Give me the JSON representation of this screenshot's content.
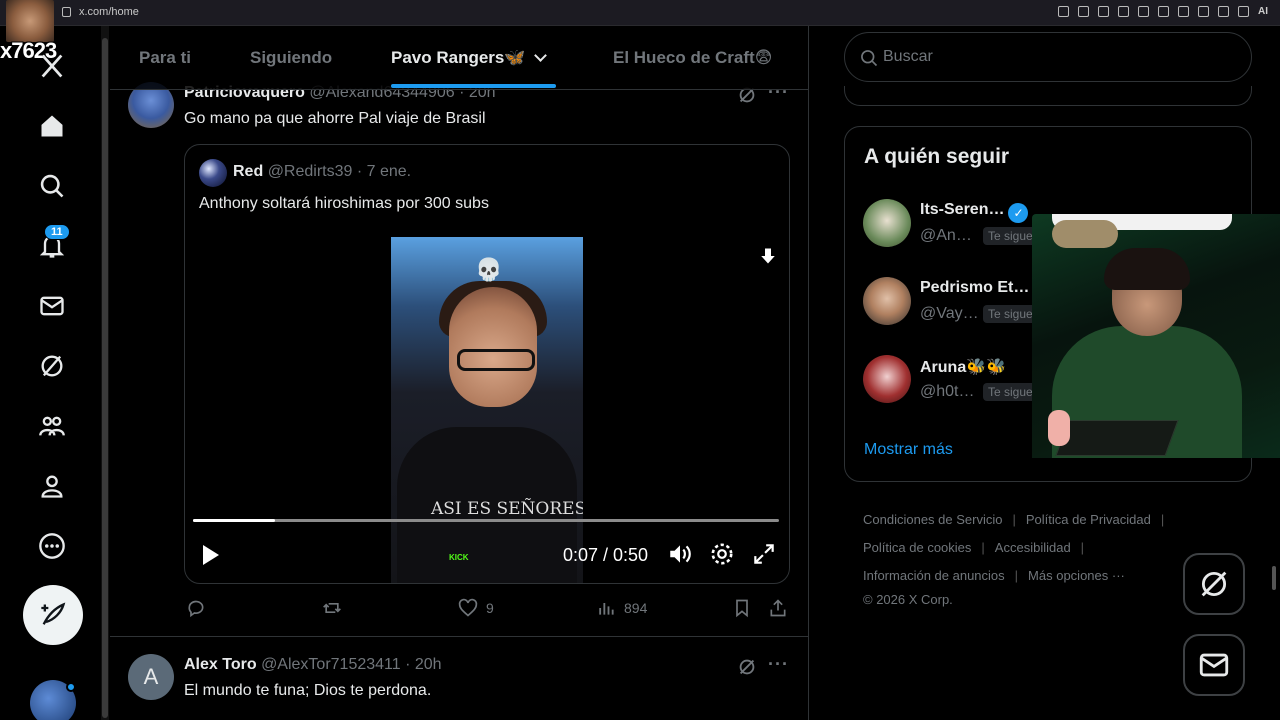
{
  "browser": {
    "url": "x.com/home",
    "ai_label": "AI"
  },
  "overlay": {
    "streamer_tag": "x7623"
  },
  "nav": {
    "notifications_count": "11"
  },
  "tabs": [
    {
      "label": "Para ti"
    },
    {
      "label": "Siguiendo"
    },
    {
      "label": "Pavo Rangers🦋"
    },
    {
      "label": "El Hueco de Craft😨"
    }
  ],
  "post1": {
    "name": "Patriciovaquero",
    "handle": "@Alexand64344906",
    "time": "· 20h",
    "text": "Go mano pa que ahorre Pal viaje de Brasil",
    "quote": {
      "name": "Red",
      "handle": "@Redirts39",
      "time": "· 7 ene.",
      "text": "Anthony soltará hiroshimas por 300 subs",
      "video_overlay": {
        "emoji": "💀",
        "shirt_text": "ASI ES SEÑORES",
        "kick_label": "KICK"
      },
      "timecode": "0:07 / 0:50",
      "progress": 0.14
    },
    "actions": {
      "replies": "",
      "reposts": "",
      "likes": "9",
      "views": "894"
    }
  },
  "post2": {
    "avatar_letter": "A",
    "name": "Alex Toro",
    "handle": "@AlexTor71523411",
    "time": "· 20h",
    "text": "El mundo te funa;  Dios te perdona."
  },
  "sidebar": {
    "search_placeholder": "Buscar",
    "who_to_follow": {
      "title": "A quién seguir",
      "items": [
        {
          "name": "Its-Seren…",
          "handle": "@An…",
          "follows_you": "Te sigue",
          "verified": true
        },
        {
          "name": "Pedrismo Et…",
          "handle": "@Vay…",
          "follows_you": "Te sigue",
          "verified": false
        },
        {
          "name": "Aruna🐝🐝",
          "handle": "@h0t…",
          "follows_you": "Te sigue",
          "verified": false
        }
      ],
      "show_more": "Mostrar más"
    },
    "footer": {
      "links": [
        "Condiciones de Servicio",
        "Política de Privacidad",
        "Política de cookies",
        "Accesibilidad",
        "Información de anuncios",
        "Más opciones ···"
      ],
      "copyright": "© 2026 X Corp."
    }
  },
  "colors": {
    "accent": "#1d9bf0",
    "background": "#000000",
    "muted": "#71767b",
    "border": "#2f3336"
  }
}
